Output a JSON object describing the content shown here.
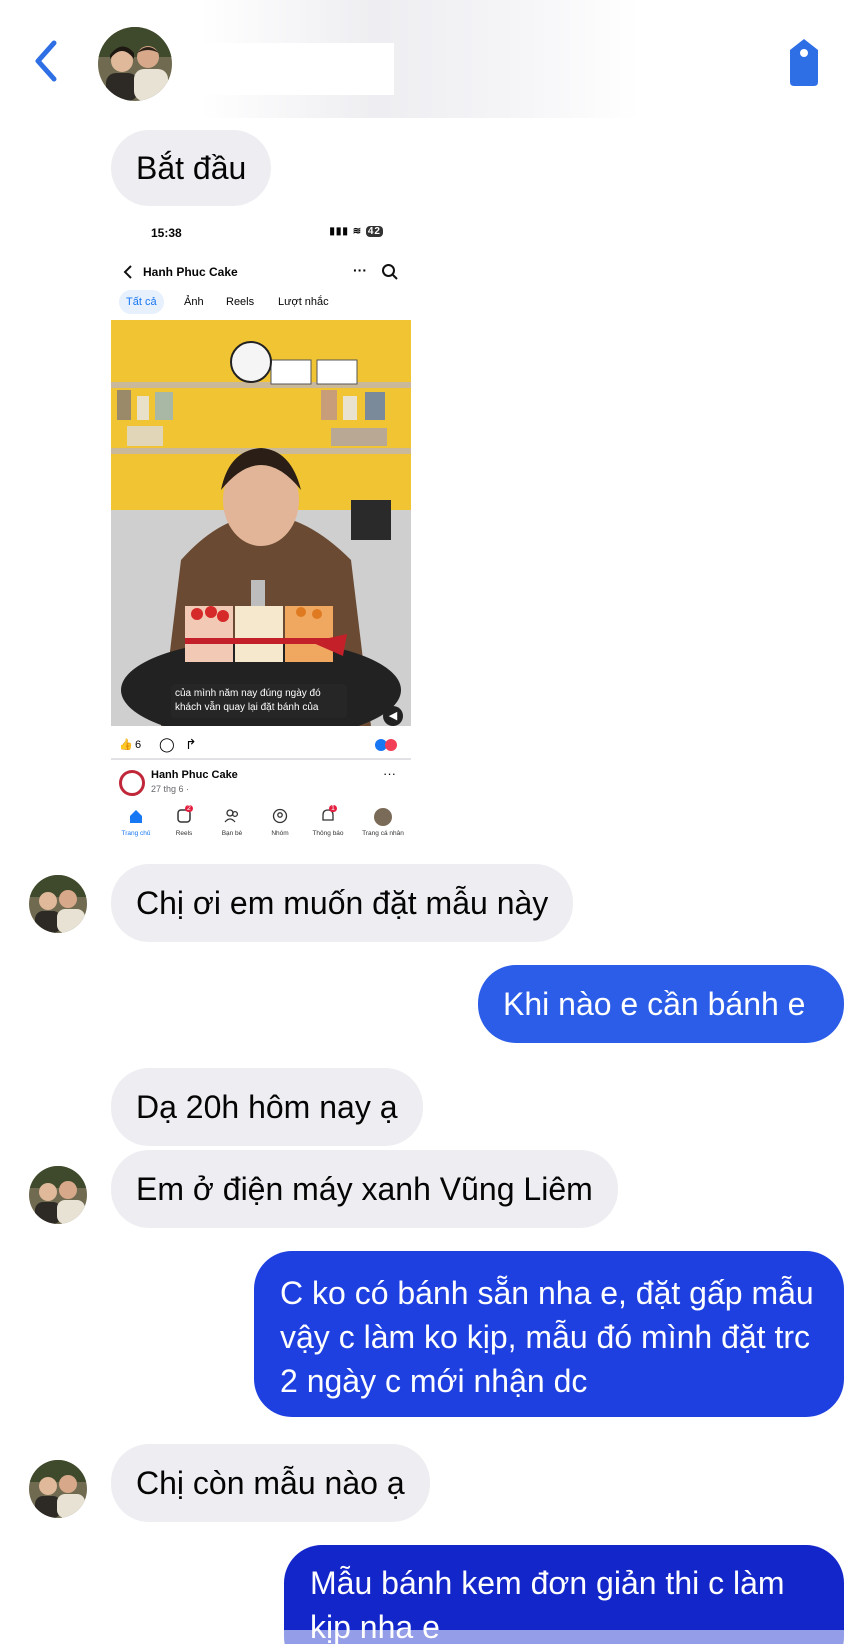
{
  "colors": {
    "accent": "#2f6fe6",
    "incoming_bubble": "#eeeef2",
    "outgoing_mid": "#1e3fe0",
    "outgoing_deep": "#1326c9"
  },
  "header": {
    "back_icon": "chevron-left-icon",
    "tag_icon": "tag-icon"
  },
  "messages": [
    {
      "id": "m1",
      "side": "in",
      "text": "Bắt đầu"
    },
    {
      "id": "m2",
      "side": "in",
      "type": "image",
      "text": ""
    },
    {
      "id": "m3",
      "side": "in",
      "text": "Chị ơi em muốn đặt mẫu này"
    },
    {
      "id": "m4",
      "side": "out",
      "text": "Khi nào e cần bánh e"
    },
    {
      "id": "m5",
      "side": "in",
      "text": "Dạ 20h hôm nay ạ"
    },
    {
      "id": "m6",
      "side": "in",
      "text": "Em ở điện máy xanh Vũng Liêm"
    },
    {
      "id": "m7",
      "side": "out",
      "text": "C ko có bánh sẵn nha e, đặt gấp mẫu vậy c làm ko kịp, mẫu đó mình đặt trc 2 ngày c mới nhận dc"
    },
    {
      "id": "m8",
      "side": "in",
      "text": "Chị còn mẫu nào ạ"
    },
    {
      "id": "m9",
      "side": "out",
      "text": "Mẫu bánh kem đơn giản thi c làm kịp nha e"
    }
  ],
  "screenshot": {
    "time": "15:38",
    "battery": "42",
    "page_name": "Hanh Phuc Cake",
    "tabs": [
      "Tất cả",
      "Ảnh",
      "Reels",
      "Lượt nhắc"
    ],
    "caption_line1": "của mình năm nay đúng ngày đó",
    "caption_line2": "khách vẫn quay lại đặt bánh của",
    "like_count": "6",
    "post_author": "Hanh Phuc Cake",
    "post_date": "27 thg 6 ·",
    "nav": [
      {
        "label": "Trang chủ",
        "icon": "home-icon",
        "badge": ""
      },
      {
        "label": "Reels",
        "icon": "reels-icon",
        "badge": "2"
      },
      {
        "label": "Bạn bè",
        "icon": "friends-icon",
        "badge": ""
      },
      {
        "label": "Nhóm",
        "icon": "groups-icon",
        "badge": ""
      },
      {
        "label": "Thông báo",
        "icon": "bell-icon",
        "badge": "1"
      },
      {
        "label": "Trang cá nhân",
        "icon": "profile-icon",
        "badge": ""
      }
    ]
  }
}
